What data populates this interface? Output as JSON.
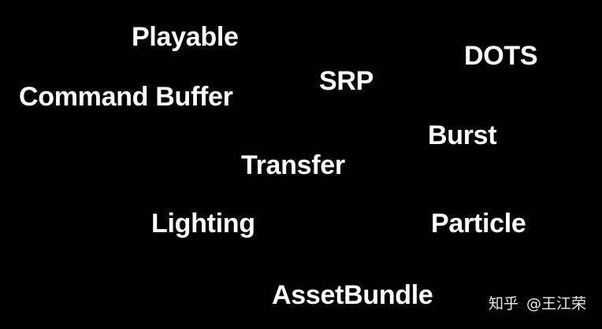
{
  "background_color": "#000000",
  "text_color": "#ffffff",
  "terms": {
    "playable": "Playable",
    "dots": "DOTS",
    "srp": "SRP",
    "command_buffer": "Command Buffer",
    "burst": "Burst",
    "transfer": "Transfer",
    "lighting": "Lighting",
    "particle": "Particle",
    "asset_bundle": "AssetBundle"
  },
  "watermark": {
    "site": "知乎",
    "author": "@王江荣"
  }
}
